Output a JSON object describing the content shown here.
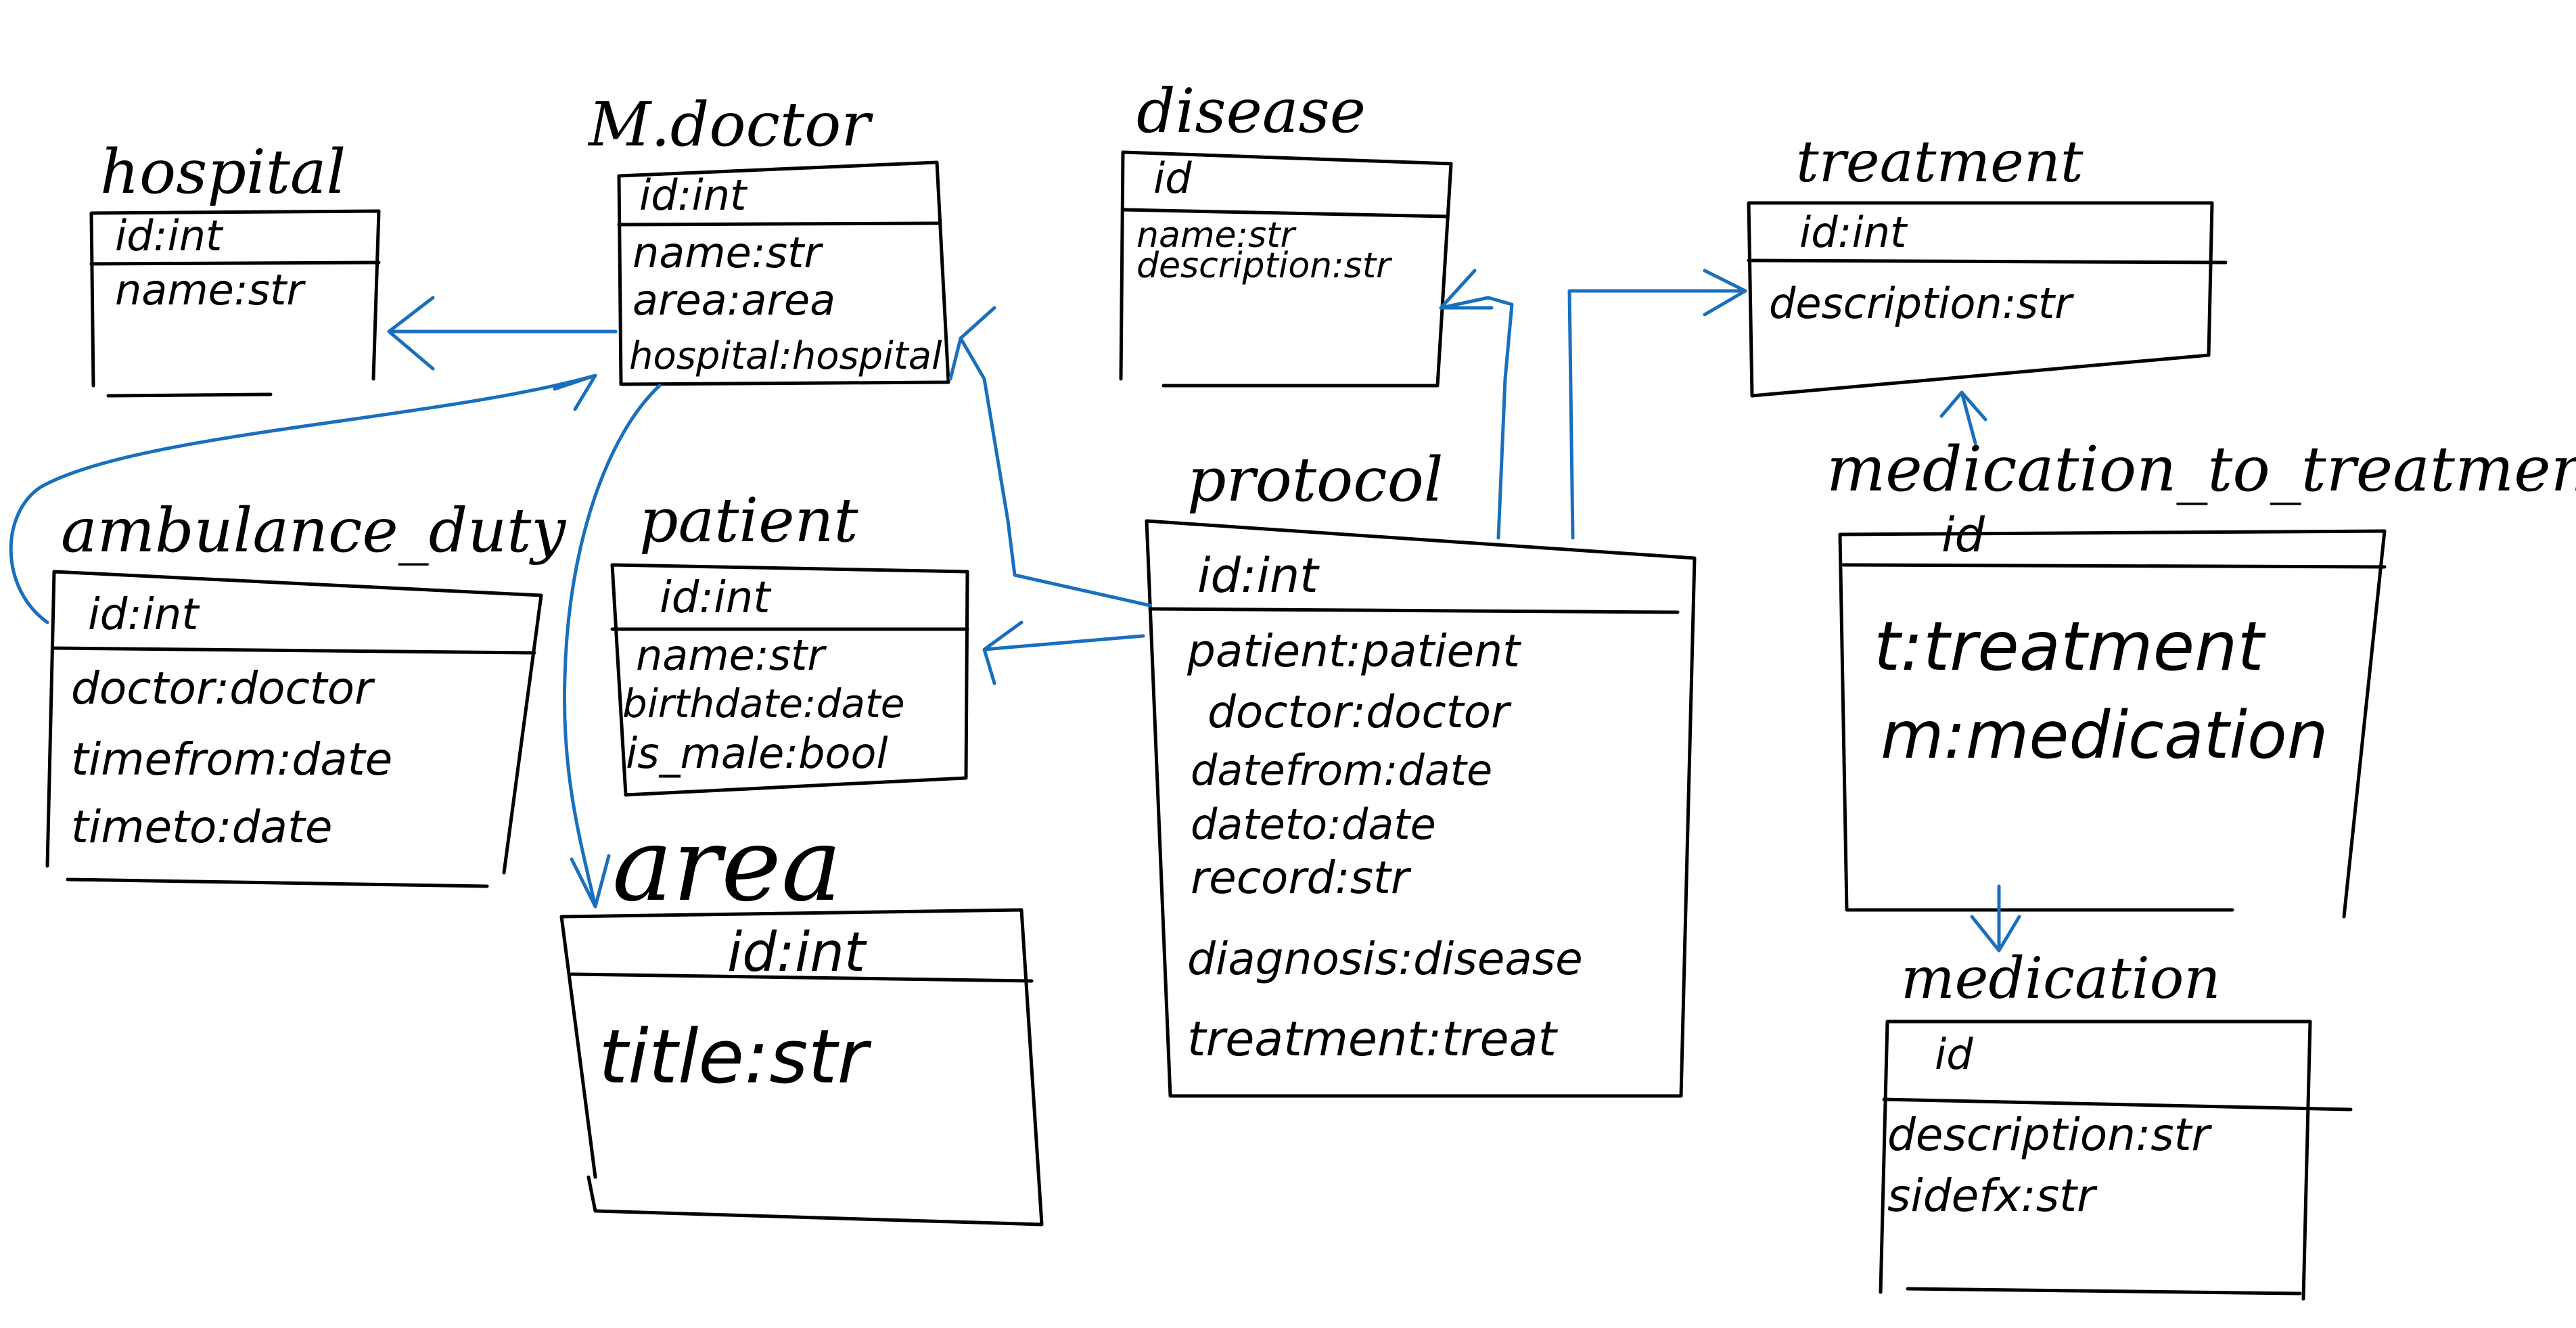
{
  "colors": {
    "ink": "#000000",
    "relation": "#1a6fbd",
    "background": "#ffffff"
  },
  "entities": {
    "hospital": {
      "title": "hospital",
      "fields": [
        "id:int",
        "name:str"
      ]
    },
    "m_doctor": {
      "title": "M.doctor",
      "fields": [
        "id:int",
        "name:str",
        "area:area",
        "hospital:hospital"
      ]
    },
    "disease": {
      "title": "disease",
      "fields": [
        "id",
        "name:str",
        "description:str"
      ]
    },
    "treatment": {
      "title": "treatment",
      "fields": [
        "id:int",
        "description:str"
      ]
    },
    "ambulance_duty": {
      "title": "ambulance_duty",
      "fields": [
        "id:int",
        "doctor:doctor",
        "timefrom:date",
        "timeto:date"
      ]
    },
    "patient": {
      "title": "patient",
      "fields": [
        "id:int",
        "name:str",
        "birthdate:date",
        "is_male:bool"
      ]
    },
    "protocol": {
      "title": "protocol",
      "fields": [
        "id:int",
        "patient:patient",
        "doctor:doctor",
        "datefrom:date",
        "dateto:date",
        "record:str",
        "diagnosis:disease",
        "treatment:treat"
      ]
    },
    "medication_to_treatment": {
      "title": "medication_to_treatment",
      "fields": [
        "id",
        "t:treatment",
        "m:medication"
      ]
    },
    "area": {
      "title": "area",
      "fields": [
        "id:int",
        "title:str"
      ]
    },
    "medication": {
      "title": "medication",
      "fields": [
        "id",
        "description:str",
        "sidefx:str"
      ]
    }
  }
}
